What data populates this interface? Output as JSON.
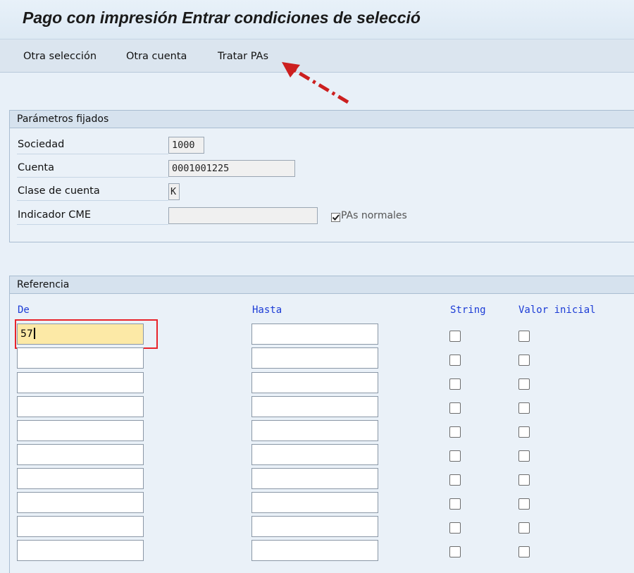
{
  "window": {
    "title": "Pago con impresión Entrar condiciones de selecció"
  },
  "toolbar": {
    "items": [
      {
        "label": "Otra selección"
      },
      {
        "label": "Otra cuenta"
      },
      {
        "label": "Tratar PAs"
      }
    ]
  },
  "fixed_params": {
    "header": "Parámetros fijados",
    "fields": [
      {
        "label": "Sociedad",
        "value": "1000"
      },
      {
        "label": "Cuenta",
        "value": "0001001225"
      },
      {
        "label": "Clase de cuenta",
        "value": "K"
      },
      {
        "label": "Indicador CME",
        "value": ""
      }
    ],
    "checkbox": {
      "label": "PAs normales",
      "checked": true
    }
  },
  "reference": {
    "header": "Referencia",
    "columns": {
      "from": "De",
      "to": "Hasta",
      "string": "String",
      "initial": "Valor inicial"
    },
    "rows": [
      {
        "from": "57",
        "to": "",
        "string": false,
        "initial": false
      },
      {
        "from": "",
        "to": "",
        "string": false,
        "initial": false
      },
      {
        "from": "",
        "to": "",
        "string": false,
        "initial": false
      },
      {
        "from": "",
        "to": "",
        "string": false,
        "initial": false
      },
      {
        "from": "",
        "to": "",
        "string": false,
        "initial": false
      },
      {
        "from": "",
        "to": "",
        "string": false,
        "initial": false
      },
      {
        "from": "",
        "to": "",
        "string": false,
        "initial": false
      },
      {
        "from": "",
        "to": "",
        "string": false,
        "initial": false
      },
      {
        "from": "",
        "to": "",
        "string": false,
        "initial": false
      },
      {
        "from": "",
        "to": "",
        "string": false,
        "initial": false
      }
    ]
  },
  "colors": {
    "highlight": "#e8232a",
    "column_header": "#1c3cd6",
    "active_field": "#fce9a6"
  }
}
